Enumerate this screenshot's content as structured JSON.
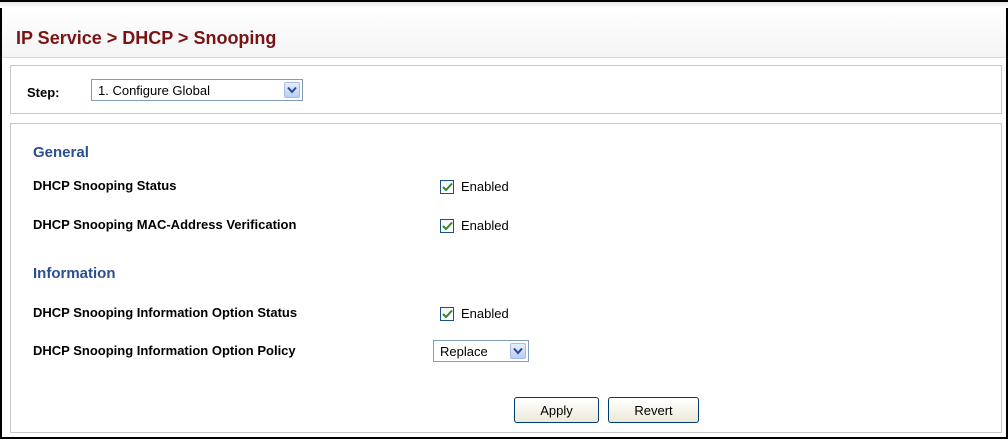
{
  "header": {
    "title": "IP Service > DHCP > Snooping"
  },
  "step": {
    "label": "Step:",
    "selected": "1. Configure Global"
  },
  "general": {
    "heading": "General",
    "snooping_status": {
      "label": "DHCP Snooping Status",
      "checked": true,
      "text": "Enabled"
    },
    "mac_verification": {
      "label": "DHCP Snooping MAC-Address Verification",
      "checked": true,
      "text": "Enabled"
    }
  },
  "information": {
    "heading": "Information",
    "option_status": {
      "label": "DHCP Snooping Information Option Status",
      "checked": true,
      "text": "Enabled"
    },
    "option_policy": {
      "label": "DHCP Snooping Information Option Policy",
      "selected": "Replace"
    }
  },
  "actions": {
    "apply": "Apply",
    "revert": "Revert"
  },
  "colors": {
    "title": "#7a1414",
    "section": "#2a4f8e",
    "check": "#2e8b2e"
  },
  "icons": {
    "checkbox": "checkmark-icon",
    "dropdown": "chevron-down-icon"
  }
}
